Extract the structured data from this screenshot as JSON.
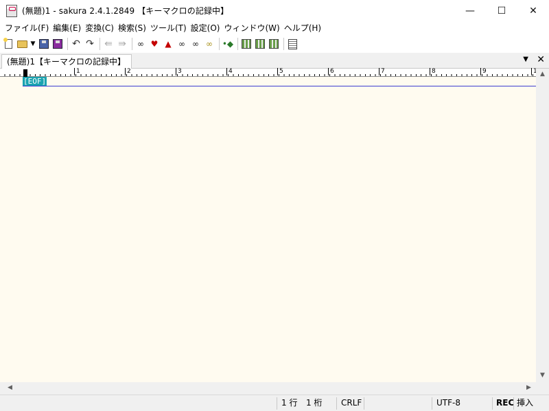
{
  "window": {
    "title": "(無題)1 - sakura 2.4.1.2849 【キーマクロの記録中】",
    "controls": {
      "minimize": "—",
      "maximize": "☐",
      "close": "✕"
    }
  },
  "menu": [
    "ファイル(F)",
    "編集(E)",
    "変換(C)",
    "検索(S)",
    "ツール(T)",
    "設定(O)",
    "ウィンドウ(W)",
    "ヘルプ(H)"
  ],
  "toolbar": {
    "icons": [
      "new-file-icon",
      "open-file-icon",
      "open-dropdown-icon",
      "save-icon",
      "save-as-icon",
      "undo-icon",
      "redo-icon",
      "jump-back-icon",
      "jump-forward-icon",
      "find-icon",
      "find-previous-icon",
      "find-next-icon",
      "replace-icon",
      "incremental-search-icon",
      "grep-icon",
      "mark-icon",
      "outline-icon",
      "compare-icon",
      "property-icon",
      "settings-icon"
    ],
    "dropdown_glyph": "▼"
  },
  "tab": {
    "label": "(無題)1【キーマクロの記録中】",
    "menu_glyph": "▼",
    "close_glyph": "✕"
  },
  "ruler": {
    "labels": [
      "1",
      "2",
      "3",
      "4",
      "5",
      "6",
      "7",
      "8",
      "9",
      "1"
    ]
  },
  "editor": {
    "eof": "[EOF]"
  },
  "scroll": {
    "up": "▲",
    "down": "▼",
    "left": "◀",
    "right": "▶"
  },
  "status": {
    "line": "1 行",
    "column": "1 桁",
    "newline": "CRLF",
    "encoding": "UTF-8",
    "rec": "REC",
    "mode": "挿入"
  }
}
